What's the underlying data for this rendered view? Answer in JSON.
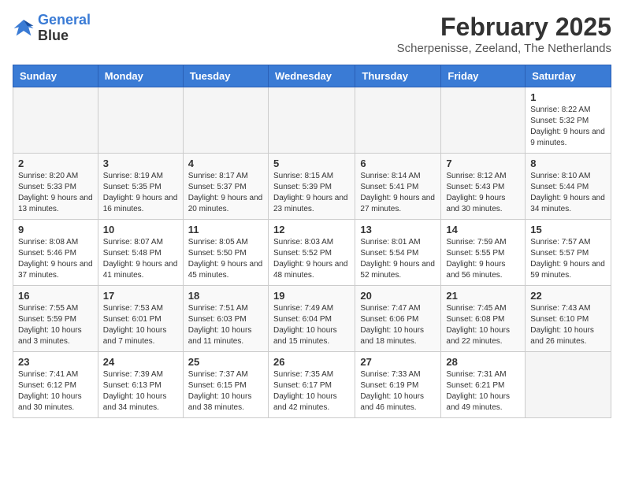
{
  "logo": {
    "line1": "General",
    "line2": "Blue"
  },
  "title": "February 2025",
  "subtitle": "Scherpenisse, Zeeland, The Netherlands",
  "days_of_week": [
    "Sunday",
    "Monday",
    "Tuesday",
    "Wednesday",
    "Thursday",
    "Friday",
    "Saturday"
  ],
  "weeks": [
    [
      {
        "day": "",
        "info": ""
      },
      {
        "day": "",
        "info": ""
      },
      {
        "day": "",
        "info": ""
      },
      {
        "day": "",
        "info": ""
      },
      {
        "day": "",
        "info": ""
      },
      {
        "day": "",
        "info": ""
      },
      {
        "day": "1",
        "info": "Sunrise: 8:22 AM\nSunset: 5:32 PM\nDaylight: 9 hours and 9 minutes."
      }
    ],
    [
      {
        "day": "2",
        "info": "Sunrise: 8:20 AM\nSunset: 5:33 PM\nDaylight: 9 hours and 13 minutes."
      },
      {
        "day": "3",
        "info": "Sunrise: 8:19 AM\nSunset: 5:35 PM\nDaylight: 9 hours and 16 minutes."
      },
      {
        "day": "4",
        "info": "Sunrise: 8:17 AM\nSunset: 5:37 PM\nDaylight: 9 hours and 20 minutes."
      },
      {
        "day": "5",
        "info": "Sunrise: 8:15 AM\nSunset: 5:39 PM\nDaylight: 9 hours and 23 minutes."
      },
      {
        "day": "6",
        "info": "Sunrise: 8:14 AM\nSunset: 5:41 PM\nDaylight: 9 hours and 27 minutes."
      },
      {
        "day": "7",
        "info": "Sunrise: 8:12 AM\nSunset: 5:43 PM\nDaylight: 9 hours and 30 minutes."
      },
      {
        "day": "8",
        "info": "Sunrise: 8:10 AM\nSunset: 5:44 PM\nDaylight: 9 hours and 34 minutes."
      }
    ],
    [
      {
        "day": "9",
        "info": "Sunrise: 8:08 AM\nSunset: 5:46 PM\nDaylight: 9 hours and 37 minutes."
      },
      {
        "day": "10",
        "info": "Sunrise: 8:07 AM\nSunset: 5:48 PM\nDaylight: 9 hours and 41 minutes."
      },
      {
        "day": "11",
        "info": "Sunrise: 8:05 AM\nSunset: 5:50 PM\nDaylight: 9 hours and 45 minutes."
      },
      {
        "day": "12",
        "info": "Sunrise: 8:03 AM\nSunset: 5:52 PM\nDaylight: 9 hours and 48 minutes."
      },
      {
        "day": "13",
        "info": "Sunrise: 8:01 AM\nSunset: 5:54 PM\nDaylight: 9 hours and 52 minutes."
      },
      {
        "day": "14",
        "info": "Sunrise: 7:59 AM\nSunset: 5:55 PM\nDaylight: 9 hours and 56 minutes."
      },
      {
        "day": "15",
        "info": "Sunrise: 7:57 AM\nSunset: 5:57 PM\nDaylight: 9 hours and 59 minutes."
      }
    ],
    [
      {
        "day": "16",
        "info": "Sunrise: 7:55 AM\nSunset: 5:59 PM\nDaylight: 10 hours and 3 minutes."
      },
      {
        "day": "17",
        "info": "Sunrise: 7:53 AM\nSunset: 6:01 PM\nDaylight: 10 hours and 7 minutes."
      },
      {
        "day": "18",
        "info": "Sunrise: 7:51 AM\nSunset: 6:03 PM\nDaylight: 10 hours and 11 minutes."
      },
      {
        "day": "19",
        "info": "Sunrise: 7:49 AM\nSunset: 6:04 PM\nDaylight: 10 hours and 15 minutes."
      },
      {
        "day": "20",
        "info": "Sunrise: 7:47 AM\nSunset: 6:06 PM\nDaylight: 10 hours and 18 minutes."
      },
      {
        "day": "21",
        "info": "Sunrise: 7:45 AM\nSunset: 6:08 PM\nDaylight: 10 hours and 22 minutes."
      },
      {
        "day": "22",
        "info": "Sunrise: 7:43 AM\nSunset: 6:10 PM\nDaylight: 10 hours and 26 minutes."
      }
    ],
    [
      {
        "day": "23",
        "info": "Sunrise: 7:41 AM\nSunset: 6:12 PM\nDaylight: 10 hours and 30 minutes."
      },
      {
        "day": "24",
        "info": "Sunrise: 7:39 AM\nSunset: 6:13 PM\nDaylight: 10 hours and 34 minutes."
      },
      {
        "day": "25",
        "info": "Sunrise: 7:37 AM\nSunset: 6:15 PM\nDaylight: 10 hours and 38 minutes."
      },
      {
        "day": "26",
        "info": "Sunrise: 7:35 AM\nSunset: 6:17 PM\nDaylight: 10 hours and 42 minutes."
      },
      {
        "day": "27",
        "info": "Sunrise: 7:33 AM\nSunset: 6:19 PM\nDaylight: 10 hours and 46 minutes."
      },
      {
        "day": "28",
        "info": "Sunrise: 7:31 AM\nSunset: 6:21 PM\nDaylight: 10 hours and 49 minutes."
      },
      {
        "day": "",
        "info": ""
      }
    ]
  ]
}
